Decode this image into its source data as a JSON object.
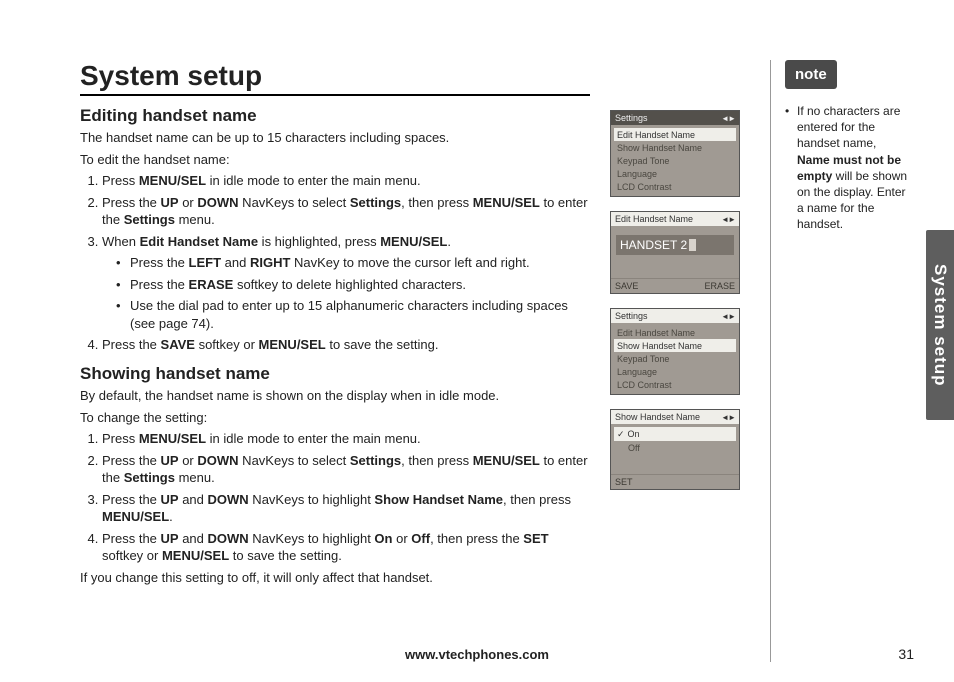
{
  "title": "System setup",
  "section1": {
    "heading": "Editing handset name",
    "intro1": "The handset name can be up to 15 characters including spaces.",
    "intro2": "To edit the handset name:",
    "steps": [
      "Press <b>MENU/SEL</b> in idle mode to enter the main menu.",
      "Press the <b>UP</b> or <b>DOWN</b> NavKeys to select <b>Settings</b>, then press <b>MENU/SEL</b> to enter the <b>Settings</b> menu.",
      "When <b>Edit Handset Name</b> is highlighted, press <b>MENU/SEL</b>.",
      "Press the <b>SAVE</b> softkey or <b>MENU/SEL</b> to save the setting."
    ],
    "substeps": [
      "Press the <b>LEFT</b> and <b>RIGHT</b> NavKey to move the cursor left and right.",
      "Press the <b>ERASE</b> softkey to delete highlighted characters.",
      "Use the dial pad to enter up to 15 alphanumeric characters including spaces (see page 74)."
    ]
  },
  "section2": {
    "heading": "Showing handset name",
    "intro1": "By default, the handset name is shown on the display when in idle mode.",
    "intro2": "To change the setting:",
    "steps": [
      "Press <b>MENU/SEL</b> in idle mode to enter the main menu.",
      "Press the <b>UP</b> or <b>DOWN</b> NavKeys to select <b>Settings</b>, then press <b>MENU/SEL</b> to enter the <b>Settings</b> menu.",
      "Press the <b>UP</b> and <b>DOWN</b> NavKeys to highlight <b>Show Handset Name</b>, then press <b>MENU/SEL</b>.",
      "Press the <b>UP</b> and <b>DOWN</b> NavKeys to highlight <b>On</b> or <b>Off</b>, then press the <b>SET</b> softkey or <b>MENU/SEL</b> to save the setting."
    ],
    "outro": "If you change this setting to off, it will only affect that handset."
  },
  "screens": {
    "s1": {
      "title": "Settings",
      "items": [
        "Edit Handset Name",
        "Show Handset Name",
        "Keypad Tone",
        "Language",
        "LCD Contrast"
      ],
      "selected": 0
    },
    "s2": {
      "title": "Edit Handset Name",
      "value": "HANDSET 2",
      "left": "SAVE",
      "right": "ERASE"
    },
    "s3": {
      "title": "Settings",
      "items": [
        "Edit Handset Name",
        "Show Handset Name",
        "Keypad Tone",
        "Language",
        "LCD Contrast"
      ],
      "selected": 1
    },
    "s4": {
      "title": "Show Handset Name",
      "items": [
        "On",
        "Off"
      ],
      "checked": 0,
      "left": "SET"
    }
  },
  "note": {
    "badge": "note",
    "text": "If no characters are entered for the handset name, <b>Name must not be empty</b> will be shown on the display. Enter a name for the handset."
  },
  "footer_url": "www.vtechphones.com",
  "page_number": "31",
  "sidetab": "System setup"
}
